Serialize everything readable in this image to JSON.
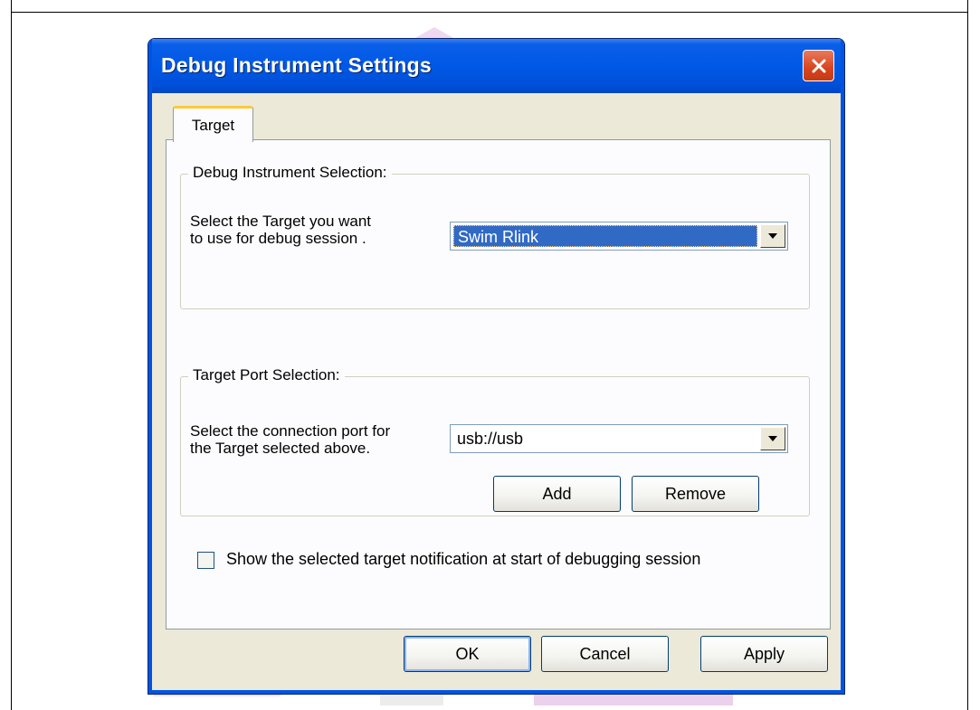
{
  "dialog": {
    "title": "Debug Instrument Settings",
    "close_icon": "close-icon",
    "tabs": [
      {
        "label": "Target",
        "selected": true
      }
    ],
    "debug_instrument_group": {
      "legend": "Debug Instrument Selection:",
      "prompt": "Select the Target you want\nto use for debug session .",
      "target_select": {
        "value": "Swim Rlink",
        "arrow_icon": "dropdown-arrow-icon"
      }
    },
    "target_port_group": {
      "legend": "Target Port Selection:",
      "prompt": "Select the connection port for\nthe Target selected above.",
      "port_select": {
        "value": "usb://usb",
        "arrow_icon": "dropdown-arrow-icon"
      },
      "add_label": "Add",
      "remove_label": "Remove"
    },
    "notification_checkbox": {
      "label": "Show the selected target notification at start of debugging session",
      "checked": false
    },
    "buttons": {
      "ok": "OK",
      "cancel": "Cancel",
      "apply": "Apply"
    }
  },
  "colors": {
    "title_bar": "#0058e6",
    "window_face": "#ece9d8",
    "selection": "#316ac5",
    "close_button": "#d8441d",
    "watermark_pink": "#e8c3e8",
    "watermark_gray": "#d8d8d8"
  }
}
